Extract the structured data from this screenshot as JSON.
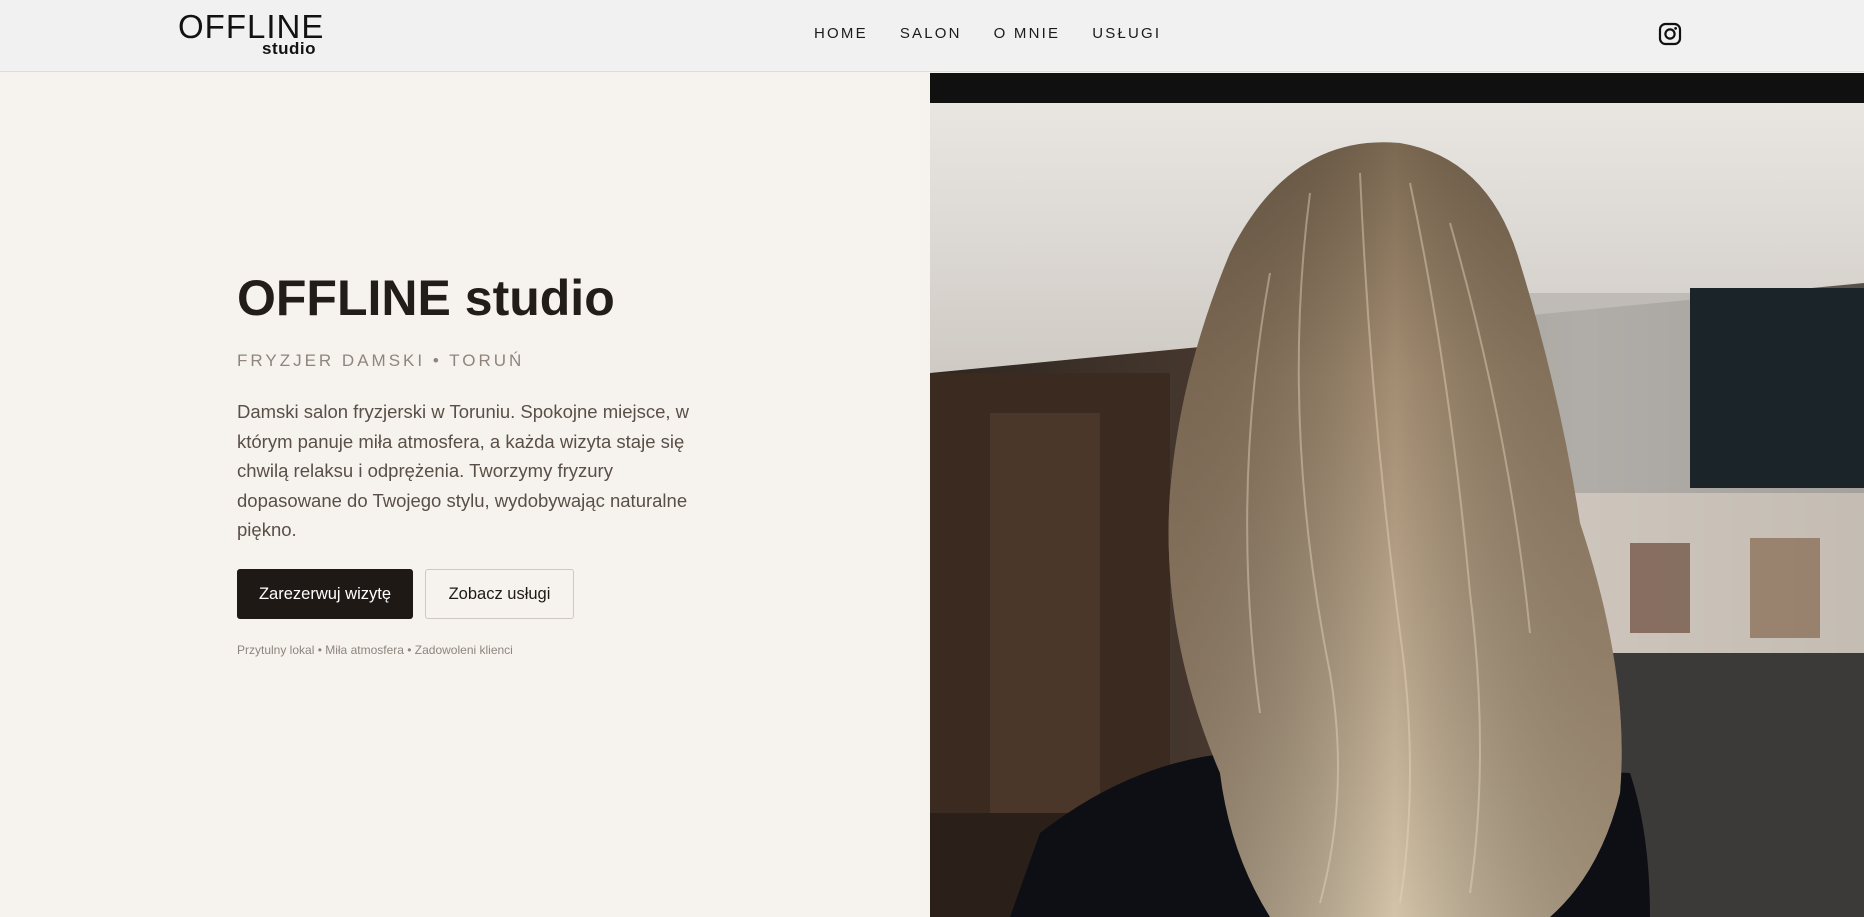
{
  "header": {
    "logo_main": "OFFLINE",
    "logo_sub": "studio",
    "nav": [
      "HOME",
      "SALON",
      "O MNIE",
      "USŁUGI"
    ],
    "social_icon": "instagram-icon"
  },
  "hero": {
    "title": "OFFLINE studio",
    "subtitle": "FRYZJER DAMSKI • TORUŃ",
    "description": "Damski salon fryzjerski w Toruniu. Spokojne miejsce, w którym panuje miła atmosfera, a każda wizyta staje się chwilą relaksu i odprężenia. Tworzymy fryzury dopasowane do Twojego stylu, wydobywając naturalne piękno.",
    "primary_button": "Zarezerwuj wizytę",
    "secondary_button": "Zobacz usługi",
    "note": "Przytulny lokal • Miła atmosfera • Zadowoleni klienci"
  },
  "colors": {
    "background": "#f6f3ef",
    "header_bg": "#f1f1f2",
    "text_dark": "#231d19",
    "text_muted": "#8f857c",
    "button_dark": "#1f1915"
  }
}
